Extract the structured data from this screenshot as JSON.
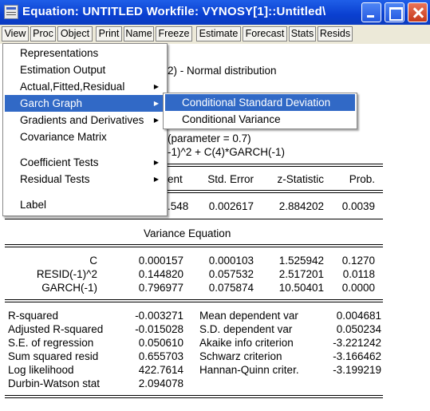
{
  "window": {
    "title": "Equation: UNTITLED   Workfile: VYNOSY[1]::Untitled\\"
  },
  "toolbar": [
    "View",
    "Proc",
    "Object",
    "Print",
    "Name",
    "Freeze",
    "Estimate",
    "Forecast",
    "Stats",
    "Resids"
  ],
  "output": {
    "header_fragment_1": "2) - Normal distribution",
    "header_fragment_2": "(parameter = 0.7)",
    "header_fragment_3": "-1)^2 + C(4)*GARCH(-1)",
    "columns": [
      "ent",
      "Std. Error",
      "z-Statistic",
      "Prob."
    ],
    "mean_row": {
      "coef": ".548",
      "se": "0.002617",
      "z": "2.884202",
      "p": "0.0039"
    },
    "variance_title": "Variance Equation",
    "variance_rows": [
      {
        "var": "C",
        "coef": "0.000157",
        "se": "0.000103",
        "z": "1.525942",
        "p": "0.1270"
      },
      {
        "var": "RESID(-1)^2",
        "coef": "0.144820",
        "se": "0.057532",
        "z": "2.517201",
        "p": "0.0118"
      },
      {
        "var": "GARCH(-1)",
        "coef": "0.796977",
        "se": "0.075874",
        "z": "10.50401",
        "p": "0.0000"
      }
    ],
    "stats_left": [
      {
        "label": "R-squared",
        "value": "-0.003271"
      },
      {
        "label": "Adjusted R-squared",
        "value": "-0.015028"
      },
      {
        "label": "S.E. of regression",
        "value": "0.050610"
      },
      {
        "label": "Sum squared resid",
        "value": "0.655703"
      },
      {
        "label": "Log likelihood",
        "value": "422.7614"
      },
      {
        "label": "Durbin-Watson stat",
        "value": "2.094078"
      }
    ],
    "stats_right": [
      {
        "label": "Mean dependent var",
        "value": "0.004681"
      },
      {
        "label": "S.D. dependent var",
        "value": "0.050234"
      },
      {
        "label": "Akaike info criterion",
        "value": "-3.221242"
      },
      {
        "label": "Schwarz criterion",
        "value": "-3.166462"
      },
      {
        "label": "Hannan-Quinn criter.",
        "value": "-3.199219"
      }
    ]
  },
  "view_menu": {
    "items": [
      "Representations",
      "Estimation Output",
      "Actual,Fitted,Residual",
      "Garch Graph",
      "Gradients and Derivatives",
      "Covariance Matrix",
      "Coefficient Tests",
      "Residual Tests",
      "Label"
    ],
    "highlighted": "Garch Graph"
  },
  "garch_submenu": {
    "items": [
      "Conditional Standard Deviation",
      "Conditional Variance"
    ],
    "highlighted": "Conditional Standard Deviation"
  },
  "colors": {
    "highlight": "#3169c6",
    "titlebar": "#0a3fd0",
    "close_button": "#c6391a"
  }
}
